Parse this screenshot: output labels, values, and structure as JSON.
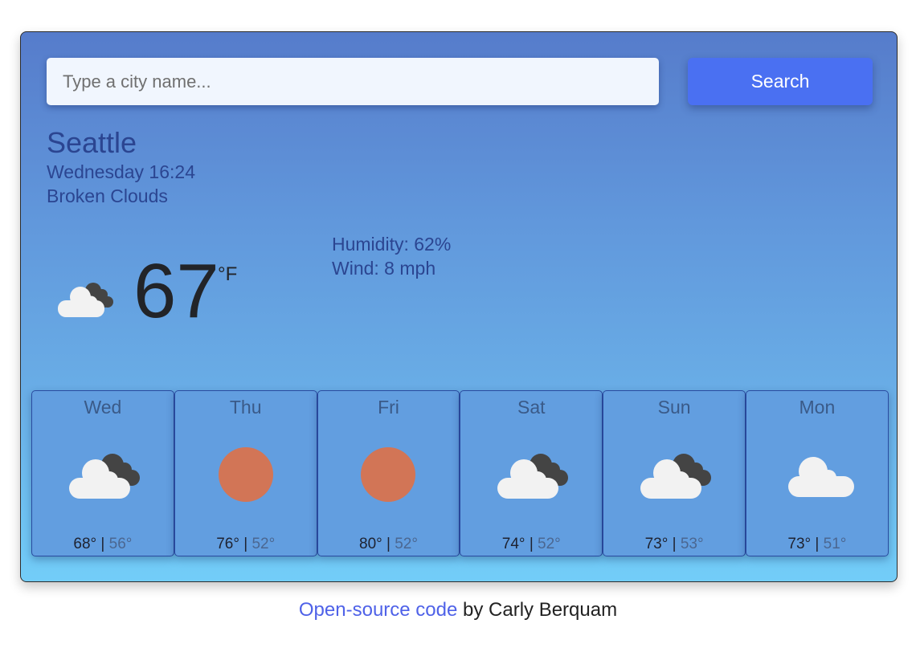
{
  "search": {
    "placeholder": "Type a city name...",
    "value": "",
    "button_label": "Search"
  },
  "current": {
    "city": "Seattle",
    "datetime": "Wednesday 16:24",
    "condition": "Broken Clouds",
    "icon": "broken-clouds-icon",
    "temperature": "67",
    "unit": "°F",
    "humidity": "Humidity: 62%",
    "wind": "Wind: 8 mph"
  },
  "forecast": [
    {
      "day": "Wed",
      "icon": "broken-clouds",
      "high": "68°",
      "low": "56°"
    },
    {
      "day": "Thu",
      "icon": "clear-sun",
      "high": "76°",
      "low": "52°"
    },
    {
      "day": "Fri",
      "icon": "clear-sun",
      "high": "80°",
      "low": "52°"
    },
    {
      "day": "Sat",
      "icon": "broken-clouds",
      "high": "74°",
      "low": "52°"
    },
    {
      "day": "Sun",
      "icon": "broken-clouds",
      "high": "73°",
      "low": "53°"
    },
    {
      "day": "Mon",
      "icon": "cloud",
      "high": "73°",
      "low": "51°"
    }
  ],
  "separator": "|",
  "footer": {
    "link_text": "Open-source code",
    "suffix": " by Carly Berquam"
  },
  "colors": {
    "accent": "#4a70f2",
    "sun": "#d27556",
    "cloud_light": "#f2f2f2",
    "cloud_dark": "#444444",
    "text_primary": "#2b4591"
  }
}
